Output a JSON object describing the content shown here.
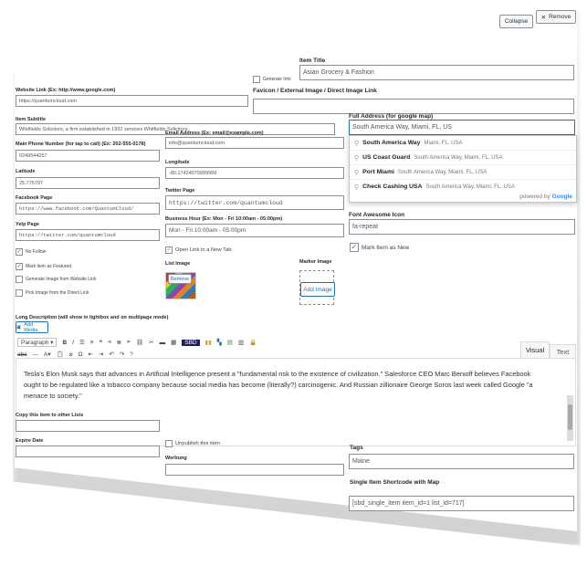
{
  "header": {
    "collapse_label": "Collapse",
    "remove_label": "Remove"
  },
  "fields": {
    "item_title": {
      "label": "Item Title",
      "value": "Asian Grocery & Fashion"
    },
    "website_link": {
      "label": "Website Link (Ex: http://www.google.com)",
      "value": "https://quantumcloud.com"
    },
    "generate_info": {
      "label": "Generate Info",
      "checked": false
    },
    "favicon": {
      "label": "Favicon / External Image / Direct Image Link",
      "value": ""
    },
    "item_subtitle": {
      "label": "Item Subtitle",
      "value": "Whitfields Solicitors, a firm established in 1992 services Whitfields Solicitors."
    },
    "full_address": {
      "label": "Full Address (for google map)",
      "value": "South America Way, Miami, FL, US"
    },
    "main_phone": {
      "label": "Main Phone Number (for tap to call) (Ex: 202-555-0178)",
      "value": "0249544257"
    },
    "email": {
      "label": "Email Address (Ex: email@example.com)",
      "value": "info@quantumcloud.com"
    },
    "latitude": {
      "label": "Latitude",
      "value": "25.775797"
    },
    "longitude": {
      "label": "Longitude",
      "value": "-80.17424079999999"
    },
    "facebook": {
      "label": "Facebook Page",
      "value": "https://www.facebook.com/QuantumCloud/"
    },
    "twitter": {
      "label": "Twitter Page",
      "value": "https://twitter.com/quantumcloud"
    },
    "yelp": {
      "label": "Yelp Page",
      "value": "https://twitter.com/quantumcloud"
    },
    "business_hour": {
      "label": "Business Hour (Ex: Mon - Fri 10:00am - 05:00pm)",
      "value": "Mon - Fri 10:00am - 05:00pm"
    },
    "font_awesome": {
      "label": "Font Awesome Icon",
      "value": "fa-repeat"
    },
    "no_follow": {
      "label": "No Follow",
      "checked": true
    },
    "open_new_tab": {
      "label": "Open Link in a New Tab",
      "checked": true
    },
    "mark_new": {
      "label": "Mark Item as New",
      "checked": true
    },
    "mark_featured": {
      "label": "Mark item as Featured",
      "checked": true
    },
    "gen_from_website": {
      "label": "Generate Image from Website Link",
      "checked": false
    },
    "pick_direct": {
      "label": "Pick Image from the Direct Link",
      "checked": false
    },
    "list_image": {
      "label": "List Image",
      "remove_label": "Remove"
    },
    "marker_image": {
      "label": "Marker Image",
      "add_label": "Add Image"
    },
    "long_description": {
      "label": "Long Description (will show in lightbox and on multipage mode)",
      "add_media_label": "Add Media"
    },
    "copy_to_lists": {
      "label": "Copy this item to other Lists",
      "value": ""
    },
    "expire_date": {
      "label": "Expire Date",
      "value": ""
    },
    "unpublish": {
      "label": "Unpublish this item",
      "checked": false
    },
    "werbung": {
      "label": "Werbung",
      "value": ""
    },
    "tags": {
      "label": "Tags",
      "value": "Maine"
    },
    "shortcode": {
      "label": "Single Item Shortcode with Map",
      "value": "[sbd_single_item item_id=1 list_id=717]"
    }
  },
  "autocomplete": {
    "items": [
      {
        "main": "South America Way",
        "secondary": "Miami, FL, USA"
      },
      {
        "main": "US Coast Guard",
        "secondary": "South America Way, Miami, FL, USA"
      },
      {
        "main": "Port Miami",
        "secondary": "South America Way, Miami, FL, USA"
      },
      {
        "main": "Check Cashing USA",
        "secondary": "South America Way, Miami, FL, USA"
      }
    ],
    "powered_by": "powered by",
    "brand": "Google"
  },
  "editor": {
    "paragraph_label": "Paragraph",
    "tabs": [
      "Visual",
      "Text"
    ],
    "content": "Tesla's Elon Musk says that advances in Artificial Intelligence present a \"fundamental risk to the existence of civilization.\" Salesforce CEO Marc Benioff believes Facebook ought to be regulated like a tobacco company because social media has become (literally?) carcinogenic. And Russian zillionaire George Soros last week called Google \"a menace to society.\""
  }
}
